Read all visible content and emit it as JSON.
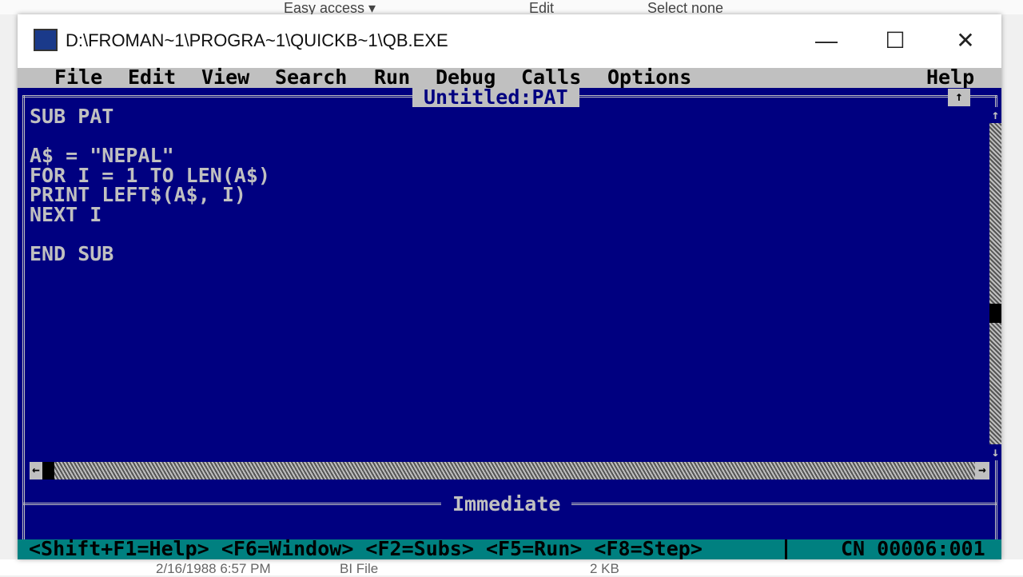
{
  "background": {
    "top_items": [
      "Easy access ▾",
      "Edit",
      "Select none"
    ],
    "bottom_items": [
      "2/16/1988 6:57 PM",
      "BI File",
      "2 KB"
    ]
  },
  "window": {
    "title": "D:\\FROMAN~1\\PROGRA~1\\QUICKB~1\\QB.EXE",
    "minimize": "—",
    "maximize": "☐",
    "close": "✕"
  },
  "menu": [
    "File",
    "Edit",
    "View",
    "Search",
    "Run",
    "Debug",
    "Calls",
    "Options",
    "Help"
  ],
  "editor": {
    "title": "Untitled:PAT",
    "code": "SUB PAT\n\nA$ = \"NEPAL\"\nFOR I = 1 TO LEN(A$)\nPRINT LEFT$(A$, I)\nNEXT I\n\nEND SUB"
  },
  "immediate": {
    "title": "Immediate"
  },
  "status": {
    "hints": "<Shift+F1=Help> <F6=Window> <F2=Subs> <F5=Run> <F8=Step>",
    "position": "CN 00006:001"
  },
  "colors": {
    "editor_bg": "#000080",
    "menu_bg": "#c0c0c0",
    "status_bg": "#008080"
  }
}
